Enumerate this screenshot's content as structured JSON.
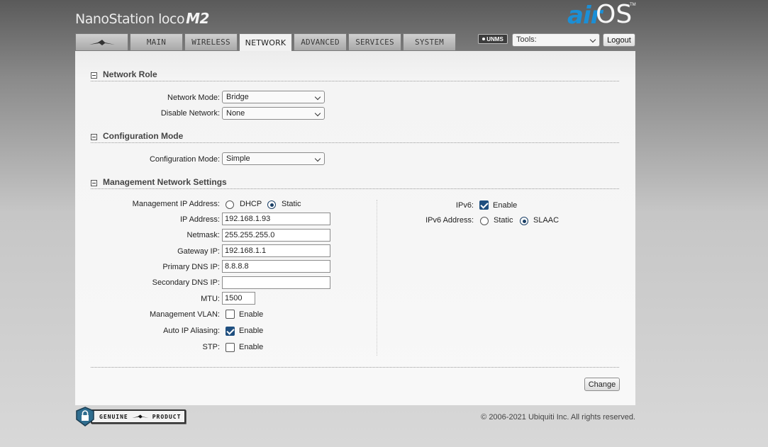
{
  "header": {
    "product": "NanoStation loco",
    "model": "M2",
    "brand_air": "air",
    "brand_os": "OS",
    "brand_tm": "TM"
  },
  "tabs": [
    {
      "id": "logo",
      "label": "",
      "icon": "ubiquiti-logo-icon"
    },
    {
      "id": "main",
      "label": "MAIN"
    },
    {
      "id": "wireless",
      "label": "WIRELESS"
    },
    {
      "id": "network",
      "label": "NETWORK",
      "active": true
    },
    {
      "id": "advanced",
      "label": "ADVANCED"
    },
    {
      "id": "services",
      "label": "SERVICES"
    },
    {
      "id": "system",
      "label": "SYSTEM"
    }
  ],
  "toolbar": {
    "unms_label": "UNMS",
    "tools_value": "Tools:",
    "logout_label": "Logout"
  },
  "network_role": {
    "title": "Network Role",
    "mode_label": "Network Mode:",
    "mode_value": "Bridge",
    "disable_label": "Disable Network:",
    "disable_value": "None"
  },
  "config_mode": {
    "title": "Configuration Mode",
    "label": "Configuration Mode:",
    "value": "Simple"
  },
  "mgmt": {
    "title": "Management Network Settings",
    "ip_mode_label": "Management IP Address:",
    "dhcp_label": "DHCP",
    "static_label": "Static",
    "ip_mode_selected": "Static",
    "ip_label": "IP Address:",
    "ip_value": "192.168.1.93",
    "netmask_label": "Netmask:",
    "netmask_value": "255.255.255.0",
    "gateway_label": "Gateway IP:",
    "gateway_value": "192.168.1.1",
    "dns1_label": "Primary DNS IP:",
    "dns1_value": "8.8.8.8",
    "dns2_label": "Secondary DNS IP:",
    "dns2_value": "",
    "mtu_label": "MTU:",
    "mtu_value": "1500",
    "vlan_label": "Management VLAN:",
    "vlan_enabled": false,
    "aliasing_label": "Auto IP Aliasing:",
    "aliasing_enabled": true,
    "stp_label": "STP:",
    "stp_enabled": false,
    "enable_label": "Enable",
    "ipv6_label": "IPv6:",
    "ipv6_enabled": true,
    "ipv6_addr_label": "IPv6 Address:",
    "ipv6_static_label": "Static",
    "ipv6_slaac_label": "SLAAC",
    "ipv6_addr_selected": "SLAAC"
  },
  "actions": {
    "change_label": "Change"
  },
  "footer": {
    "genuine_label": "GENUINE",
    "product_label": "PRODUCT",
    "copyright": "© 2006-2021 Ubiquiti Inc. All rights reserved."
  },
  "colors": {
    "accent_blue": "#1b8fd6",
    "checkbox_blue": "#1f4f7f"
  }
}
